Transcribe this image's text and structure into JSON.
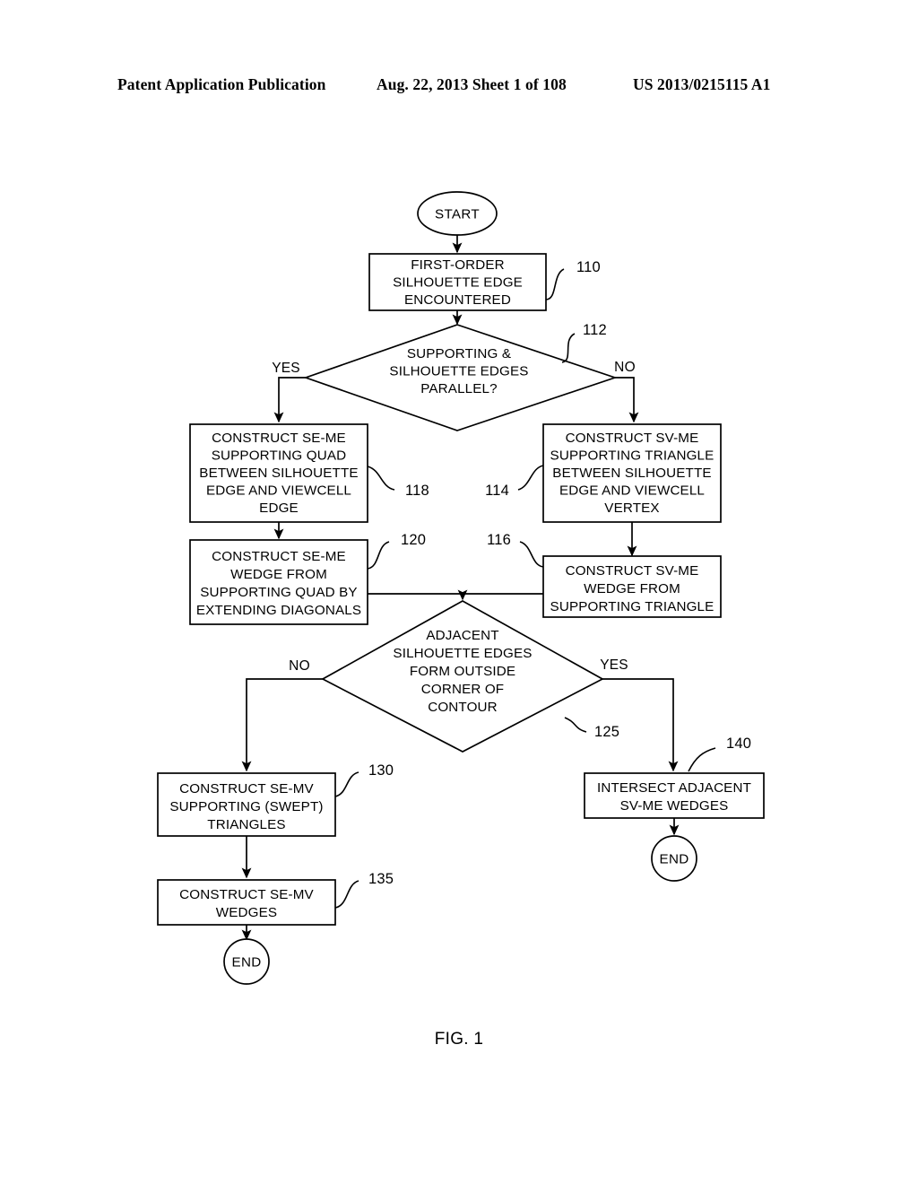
{
  "header": {
    "left": "Patent Application Publication",
    "middle": "Aug. 22, 2013  Sheet 1 of 108",
    "right": "US 2013/0215115 A1"
  },
  "figure": {
    "caption": "FIG. 1",
    "type": "flowchart"
  },
  "flowchart": {
    "start_label": "START",
    "nodes": {
      "start": {
        "label": "START",
        "shape": "terminator"
      },
      "n110": {
        "ref": "110",
        "shape": "process",
        "lines": [
          "FIRST-ORDER",
          "SILHOUETTE EDGE",
          "ENCOUNTERED"
        ]
      },
      "n112": {
        "ref": "112",
        "shape": "decision",
        "lines": [
          "SUPPORTING &",
          "SILHOUETTE EDGES",
          "PARALLEL?"
        ],
        "branch_left": "YES",
        "branch_right": "NO"
      },
      "n118": {
        "ref": "118",
        "shape": "process",
        "lines": [
          "CONSTRUCT SE-ME",
          "SUPPORTING QUAD",
          "BETWEEN SILHOUETTE",
          "EDGE AND VIEWCELL",
          "EDGE"
        ]
      },
      "n114": {
        "ref": "114",
        "shape": "process",
        "lines": [
          "CONSTRUCT SV-ME",
          "SUPPORTING TRIANGLE",
          "BETWEEN SILHOUETTE",
          "EDGE AND VIEWCELL",
          "VERTEX"
        ]
      },
      "n120": {
        "ref": "120",
        "shape": "process",
        "lines": [
          "CONSTRUCT SE-ME",
          "WEDGE FROM",
          "SUPPORTING QUAD BY",
          "EXTENDING DIAGONALS"
        ]
      },
      "n116": {
        "ref": "116",
        "shape": "process",
        "lines": [
          "CONSTRUCT SV-ME",
          "WEDGE FROM",
          "SUPPORTING TRIANGLE"
        ]
      },
      "n125": {
        "ref": "125",
        "shape": "decision",
        "lines": [
          "ADJACENT",
          "SILHOUETTE EDGES",
          "FORM OUTSIDE",
          "CORNER OF",
          "CONTOUR"
        ],
        "branch_left": "NO",
        "branch_right": "YES"
      },
      "n130": {
        "ref": "130",
        "shape": "process",
        "lines": [
          "CONSTRUCT SE-MV",
          "SUPPORTING (SWEPT)",
          "TRIANGLES"
        ]
      },
      "n135": {
        "ref": "135",
        "shape": "process",
        "lines": [
          "CONSTRUCT SE-MV",
          "WEDGES"
        ]
      },
      "n140": {
        "ref": "140",
        "shape": "process",
        "lines": [
          "INTERSECT ADJACENT",
          "SV-ME WEDGES"
        ]
      },
      "end_left": {
        "label": "END",
        "shape": "terminator"
      },
      "end_right": {
        "label": "END",
        "shape": "terminator"
      }
    }
  },
  "colors": {
    "ink": "#000000",
    "paper": "#ffffff"
  }
}
